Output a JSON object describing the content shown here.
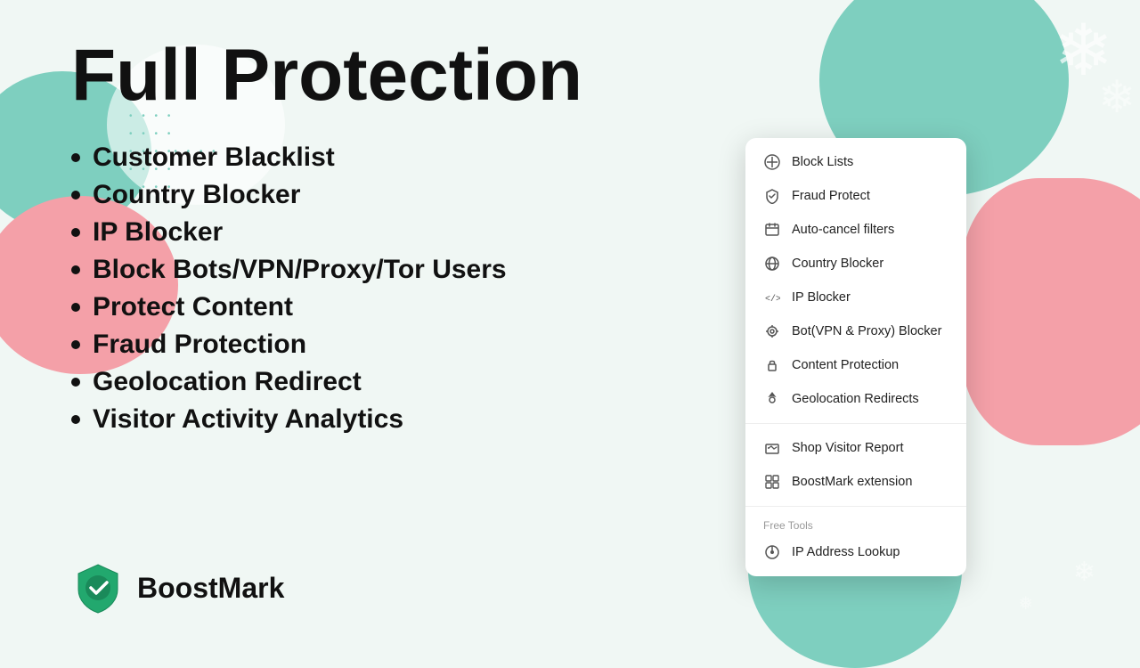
{
  "page": {
    "title": "Full Protection",
    "background_color": "#f0f7f4"
  },
  "features": {
    "items": [
      "Customer Blacklist",
      "Country Blocker",
      "IP Blocker",
      "Block Bots/VPN/Proxy/Tor Users",
      "Protect Content",
      "Fraud Protection",
      "Geolocation Redirect",
      "Visitor Activity Analytics"
    ]
  },
  "logo": {
    "text": "BoostMark"
  },
  "dropdown": {
    "sections": [
      {
        "items": [
          {
            "label": "Block Lists",
            "icon": "block-lists-icon"
          },
          {
            "label": "Fraud Protect",
            "icon": "fraud-protect-icon"
          },
          {
            "label": "Auto-cancel filters",
            "icon": "auto-cancel-icon"
          },
          {
            "label": "Country Blocker",
            "icon": "country-blocker-icon"
          },
          {
            "label": "IP Blocker",
            "icon": "ip-blocker-icon"
          },
          {
            "label": "Bot(VPN & Proxy) Blocker",
            "icon": "bot-blocker-icon"
          },
          {
            "label": "Content Protection",
            "icon": "content-protection-icon"
          },
          {
            "label": "Geolocation Redirects",
            "icon": "geolocation-icon"
          }
        ]
      },
      {
        "items": [
          {
            "label": "Shop Visitor Report",
            "icon": "shop-report-icon"
          },
          {
            "label": "BoostMark extension",
            "icon": "extension-icon"
          }
        ]
      },
      {
        "label": "Free Tools",
        "items": [
          {
            "label": "IP Address Lookup",
            "icon": "ip-lookup-icon"
          }
        ]
      }
    ]
  }
}
